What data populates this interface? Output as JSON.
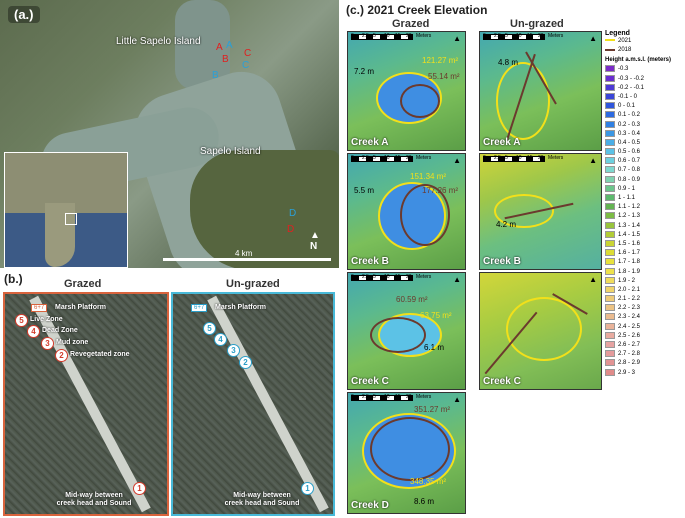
{
  "panel_a": {
    "tag": "(a.)",
    "labels": {
      "little_sapelo": "Little Sapelo Island",
      "sapelo": "Sapelo Island",
      "scale": "4 km",
      "north": "N"
    },
    "sites": [
      {
        "letter": "A",
        "color": "#e02020"
      },
      {
        "letter": "A",
        "color": "#2aa0d8"
      },
      {
        "letter": "B",
        "color": "#e02020"
      },
      {
        "letter": "B",
        "color": "#2aa0d8"
      },
      {
        "letter": "C",
        "color": "#e02020"
      },
      {
        "letter": "C",
        "color": "#2aa0d8"
      },
      {
        "letter": "D",
        "color": "#2aa0d8"
      },
      {
        "letter": "D",
        "color": "#e02020"
      }
    ]
  },
  "panel_b": {
    "tag": "(b.)",
    "grazed": {
      "title": "Grazed",
      "platform_box": "6+7",
      "platform": "Marsh Platform",
      "zones": [
        {
          "n": "5",
          "label": "Live Zone"
        },
        {
          "n": "4",
          "label": "Dead Zone"
        },
        {
          "n": "3",
          "label": "Mud zone"
        },
        {
          "n": "2",
          "label": "Revegetated zone"
        }
      ],
      "mid_n": "1",
      "mid_line1": "Mid-way between",
      "mid_line2": "creek head and Sound"
    },
    "ungrazed": {
      "title": "Un-grazed",
      "platform_box": "6+7",
      "platform": "Marsh Platform",
      "zones": [
        "5",
        "4",
        "3",
        "2"
      ],
      "mid_n": "1",
      "mid_line1": "Mid-way between",
      "mid_line2": "creek head and Sound"
    }
  },
  "panel_c": {
    "tag": "(c.) 2021 Creek Elevation",
    "col_grazed": "Grazed",
    "col_ungrazed": "Un-grazed",
    "scale_ticks": [
      "0",
      "2.5",
      "5",
      "10",
      "15",
      "20"
    ],
    "scale_unit": "Meters",
    "north": "N",
    "maps": [
      {
        "label": "Creek A",
        "dist": "7.2 m",
        "area_2021": "121.27 m²",
        "area_2018": "55.14 m²"
      },
      {
        "label": "Creek A",
        "dist": "4.8 m",
        "area_2021": "",
        "area_2018": ""
      },
      {
        "label": "Creek B",
        "dist": "5.5 m",
        "area_2021": "151.34 m²",
        "area_2018": "177.26 m²"
      },
      {
        "label": "Creek B",
        "dist": "4.2 m",
        "area_2021": "",
        "area_2018": ""
      },
      {
        "label": "Creek C",
        "dist": "6.1 m",
        "area_2021": "63.75 m²",
        "area_2018": "60.59 m²"
      },
      {
        "label": "Creek C",
        "dist": "",
        "area_2021": "",
        "area_2018": ""
      },
      {
        "label": "Creek D",
        "dist": "8.6 m",
        "area_2021": "348.35 m²",
        "area_2018": "351.27 m²"
      }
    ]
  },
  "legend": {
    "title": "Legend",
    "lines": [
      {
        "label": "2021",
        "color": "#f2e01a"
      },
      {
        "label": "2018",
        "color": "#6b3a2e"
      }
    ],
    "ramp_title": "Height a.m.s.l. (meters)",
    "bins": [
      {
        "label": "-0.3",
        "color": "#7a2bc8"
      },
      {
        "label": "-0.3 - -0.2",
        "color": "#6a2ed0"
      },
      {
        "label": "-0.2 - -0.1",
        "color": "#4d3ad6"
      },
      {
        "label": "-0.1 - 0",
        "color": "#3a46d8"
      },
      {
        "label": "0 - 0.1",
        "color": "#2f56dc"
      },
      {
        "label": "0.1 - 0.2",
        "color": "#2d6ae0"
      },
      {
        "label": "0.2 - 0.3",
        "color": "#3080e2"
      },
      {
        "label": "0.3 - 0.4",
        "color": "#3c98e4"
      },
      {
        "label": "0.4 - 0.5",
        "color": "#4aaee6"
      },
      {
        "label": "0.5 - 0.6",
        "color": "#5cc2e6"
      },
      {
        "label": "0.6 - 0.7",
        "color": "#6ed0df"
      },
      {
        "label": "0.7 - 0.8",
        "color": "#7fd8cf"
      },
      {
        "label": "0.8 - 0.9",
        "color": "#80d2b0"
      },
      {
        "label": "0.9 - 1",
        "color": "#6cc68c"
      },
      {
        "label": "1 - 1.1",
        "color": "#5dba6e"
      },
      {
        "label": "1.1 - 1.2",
        "color": "#64b452"
      },
      {
        "label": "1.2 - 1.3",
        "color": "#7cbc45"
      },
      {
        "label": "1.3 - 1.4",
        "color": "#98c43c"
      },
      {
        "label": "1.4 - 1.5",
        "color": "#b2cc36"
      },
      {
        "label": "1.5 - 1.6",
        "color": "#cad434"
      },
      {
        "label": "1.6 - 1.7",
        "color": "#dcdc36"
      },
      {
        "label": "1.7 - 1.8",
        "color": "#e8e23e"
      },
      {
        "label": "1.8 - 1.9",
        "color": "#eee24c"
      },
      {
        "label": "1.9 - 2",
        "color": "#f0dc5c"
      },
      {
        "label": "2.0 - 2.1",
        "color": "#f0d46a"
      },
      {
        "label": "2.1 - 2.2",
        "color": "#eecb78"
      },
      {
        "label": "2.2 - 2.3",
        "color": "#ecc384"
      },
      {
        "label": "2.3 - 2.4",
        "color": "#eabb90"
      },
      {
        "label": "2.4 - 2.5",
        "color": "#e9b39a"
      },
      {
        "label": "2.5 - 2.6",
        "color": "#e8aba0"
      },
      {
        "label": "2.6 - 2.7",
        "color": "#e6a3a2"
      },
      {
        "label": "2.7 - 2.8",
        "color": "#e49b9c"
      },
      {
        "label": "2.8 - 2.9",
        "color": "#e29494"
      },
      {
        "label": "2.9 - 3",
        "color": "#e08c8a"
      }
    ]
  }
}
